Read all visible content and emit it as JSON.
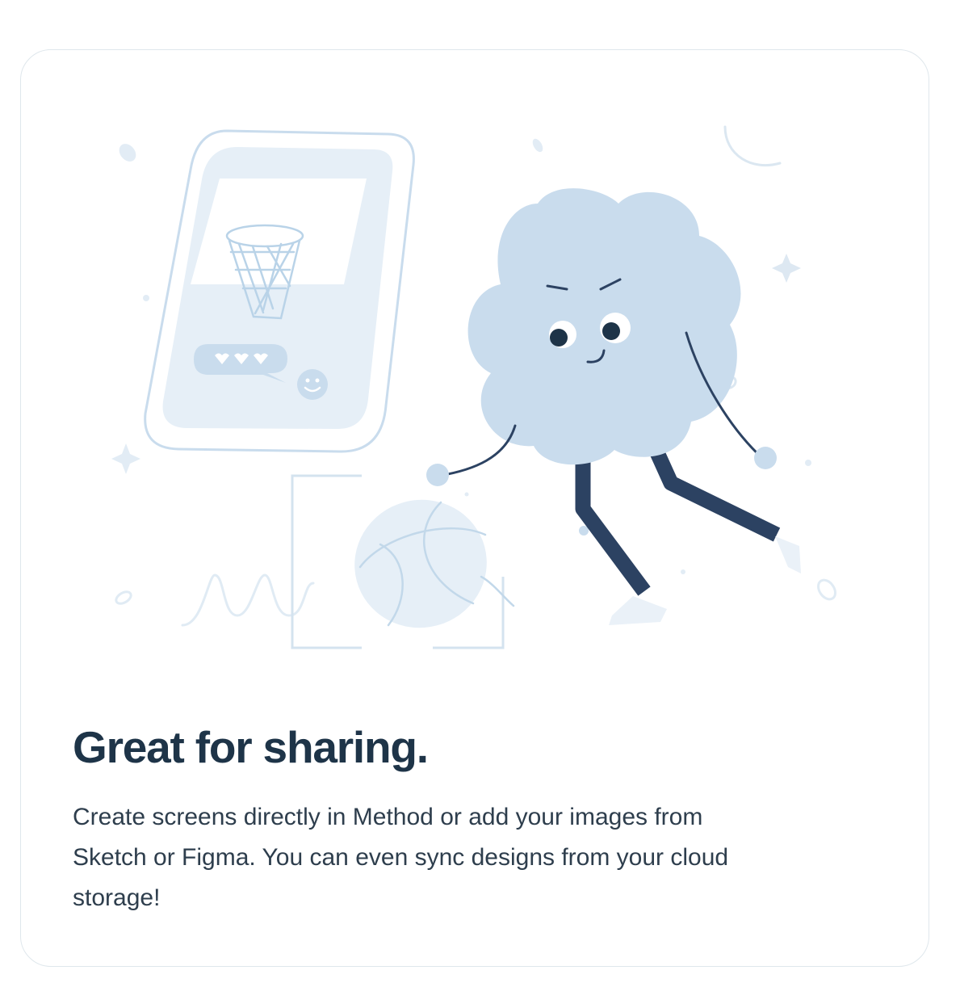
{
  "card": {
    "title": "Great for sharing.",
    "description": "Create screens directly in Method or add your images from Sketch or Figma. You can even sync designs from your cloud storage!"
  },
  "illustration": {
    "elements": [
      "phone-icon",
      "basketball-hoop-icon",
      "chat-bubble-hearts-icon",
      "smiley-icon",
      "cloud-character",
      "basketball-icon",
      "scribble",
      "sparkle-icon"
    ]
  },
  "colors": {
    "card_border": "#dfe7ec",
    "title": "#1e3448",
    "body_text": "#2e3e4d",
    "illustration_light": "#e6eff7",
    "illustration_mid": "#c9dced",
    "illustration_line": "#b9d3e8",
    "character_dark": "#2c4262"
  }
}
